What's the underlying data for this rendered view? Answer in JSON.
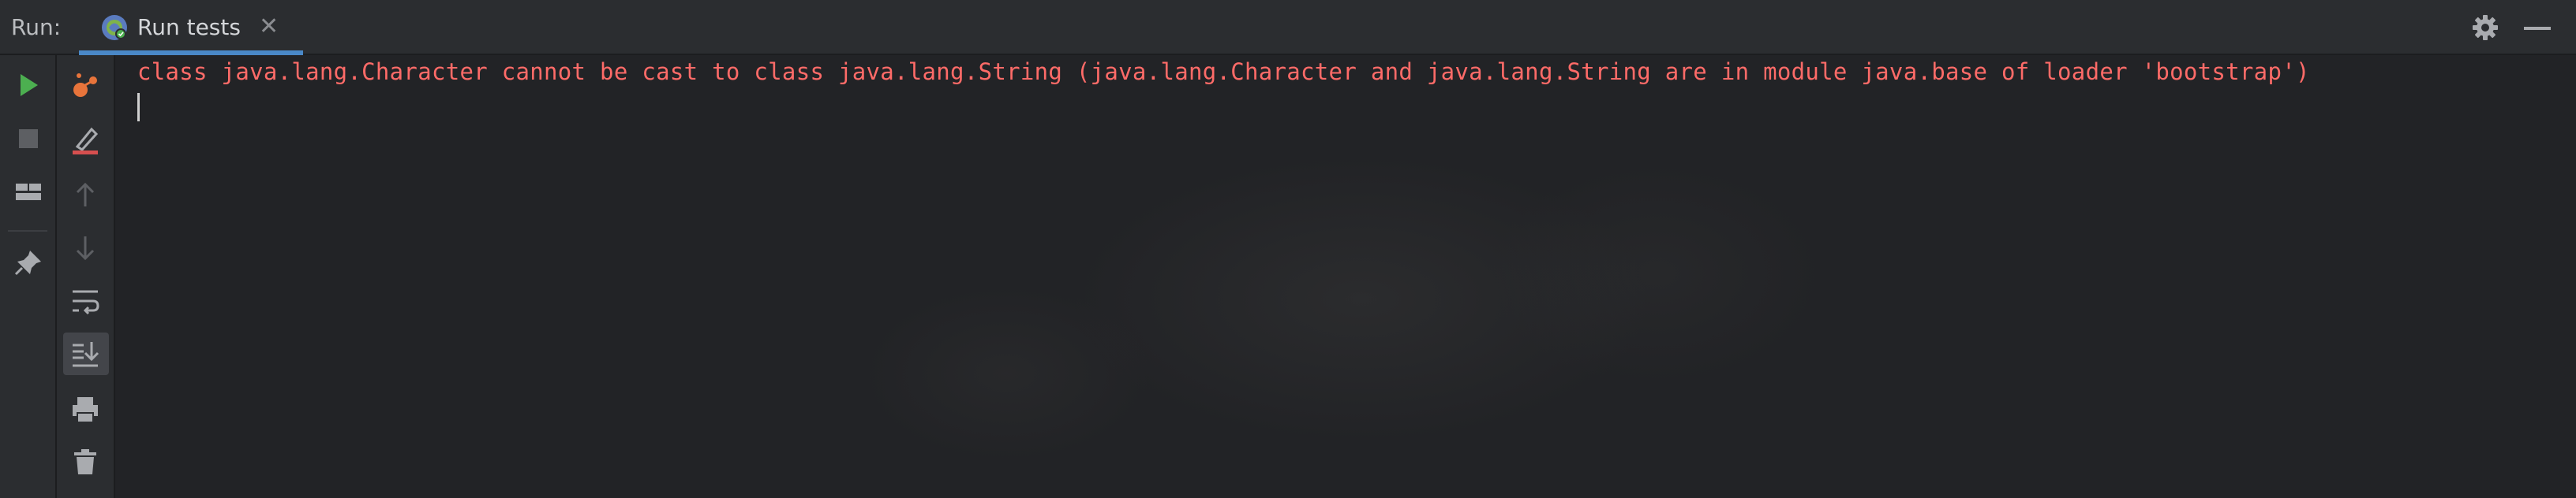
{
  "header": {
    "run_label": "Run:",
    "tab": {
      "label": "Run tests",
      "close_glyph": "✕",
      "icon": "clojure-test-icon"
    },
    "settings_icon": "gear-icon",
    "minimize_icon": "minimize-icon"
  },
  "left_toolbar": [
    {
      "name": "rerun-icon",
      "color": "#4caf50"
    },
    {
      "name": "stop-icon",
      "color": "#6e7074"
    },
    {
      "name": "layout-icon",
      "color": "#a9abaf"
    },
    {
      "name": "pin-icon",
      "color": "#a9abaf"
    }
  ],
  "console_toolbar": [
    {
      "name": "debug-icon",
      "color": "#e8743b"
    },
    {
      "name": "clear-output-icon",
      "color": "#d64f4f"
    },
    {
      "name": "up-arrow-icon",
      "color": "#6e7074"
    },
    {
      "name": "down-arrow-icon",
      "color": "#6e7074"
    },
    {
      "name": "soft-wrap-icon",
      "color": "#a9abaf"
    },
    {
      "name": "scroll-to-end-icon",
      "color": "#a9abaf"
    },
    {
      "name": "print-icon",
      "color": "#a9abaf"
    },
    {
      "name": "trash-icon",
      "color": "#a9abaf"
    }
  ],
  "console": {
    "lines": [
      "class java.lang.Character cannot be cast to class java.lang.String (java.lang.Character and java.lang.String are in module java.base of loader 'bootstrap')"
    ],
    "error_color": "#ff6b68"
  }
}
